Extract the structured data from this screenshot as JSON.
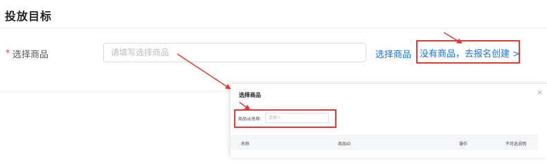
{
  "section": {
    "title": "投放目标"
  },
  "form": {
    "required_mark": "*",
    "product_label": "选择商品",
    "product_placeholder": "请填写选择商品",
    "select_link": "选择商品",
    "create_link": "没有商品，去报名创建 >"
  },
  "modal": {
    "title": "选择商品",
    "close_icon": "×",
    "search_label": "商品id/名称:",
    "search_placeholder": "请输入",
    "columns": [
      "名称",
      "商品ID",
      "操作",
      "不可选说明"
    ]
  },
  "colors": {
    "highlight": "#e53935",
    "link": "#1a73e8",
    "required": "#e23c3c"
  }
}
